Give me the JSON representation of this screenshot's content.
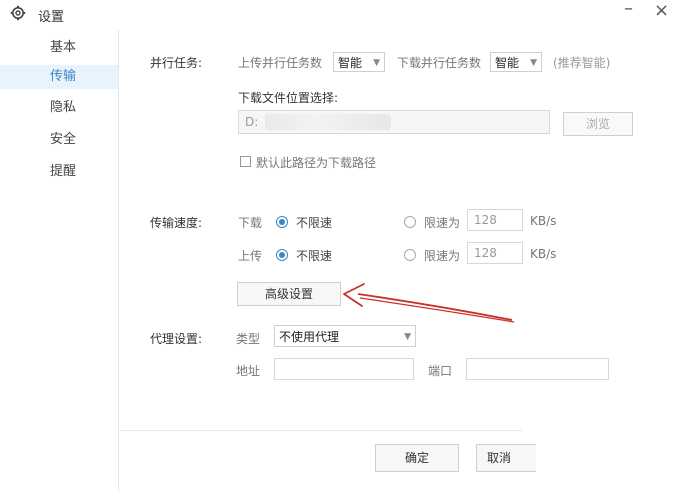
{
  "window": {
    "title": "设置",
    "minimize_label": "–",
    "close_label": "×"
  },
  "sidebar": {
    "items": [
      {
        "label": "基本"
      },
      {
        "label": "传输"
      },
      {
        "label": "隐私"
      },
      {
        "label": "安全"
      },
      {
        "label": "提醒"
      }
    ],
    "active_index": 1
  },
  "parallel": {
    "label": "并行任务:",
    "upload_label": "上传并行任务数",
    "upload_value": "智能",
    "download_label": "下载并行任务数",
    "download_value": "智能",
    "hint": "(推荐智能)"
  },
  "download_path": {
    "label": "下载文件位置选择:",
    "value": "D:",
    "browse_label": "浏览",
    "default_checkbox_label": "默认此路径为下载路径",
    "default_checked": false
  },
  "speed": {
    "label": "传输速度:",
    "download": {
      "label": "下载",
      "unlimited_label": "不限速",
      "unlimited_selected": true,
      "limit_label": "限速为",
      "limit_value": "128",
      "unit": "KB/s"
    },
    "upload": {
      "label": "上传",
      "unlimited_label": "不限速",
      "unlimited_selected": true,
      "limit_label": "限速为",
      "limit_value": "128",
      "unit": "KB/s"
    },
    "advanced_label": "高级设置"
  },
  "proxy": {
    "label": "代理设置:",
    "type_label": "类型",
    "type_value": "不使用代理",
    "address_label": "地址",
    "address_value": "",
    "port_label": "端口",
    "port_value": ""
  },
  "footer": {
    "ok_label": "确定",
    "cancel_label": "取消"
  },
  "colors": {
    "accent": "#3b86c4",
    "annotation_arrow": "#c9302c",
    "active_bg": "#e9f3fb"
  }
}
